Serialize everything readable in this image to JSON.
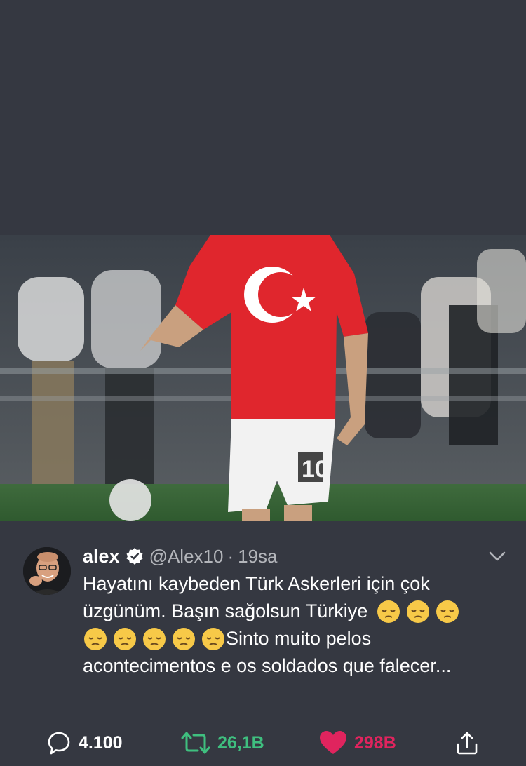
{
  "tweet": {
    "name": "alex",
    "handle": "@Alex10",
    "separator": "·",
    "time": "19sa",
    "text_line1": "Hayatını kaybeden Türk Askerleri için çok",
    "text_line2": "üzgünüm. Başın sağolsun Türkiye",
    "text_line3": "Sinto muito pelos",
    "text_line4": "acontecimentos e os soldados que falecer...",
    "emoji_name": "pensive-face-emoji",
    "emoji_count_line2": 3,
    "emoji_count_line3": 5
  },
  "actions": {
    "replies": "4.100",
    "retweets": "26,1B",
    "likes": "298B"
  },
  "colors": {
    "background": "#353841",
    "retweet": "#3fbf7f",
    "like": "#e0245e",
    "secondary_text": "#b3b5ba"
  },
  "icons": {
    "verified": "verified-badge-icon",
    "more": "chevron-down-icon",
    "reply": "reply-icon",
    "retweet": "retweet-icon",
    "like": "heart-icon",
    "share": "share-icon"
  }
}
